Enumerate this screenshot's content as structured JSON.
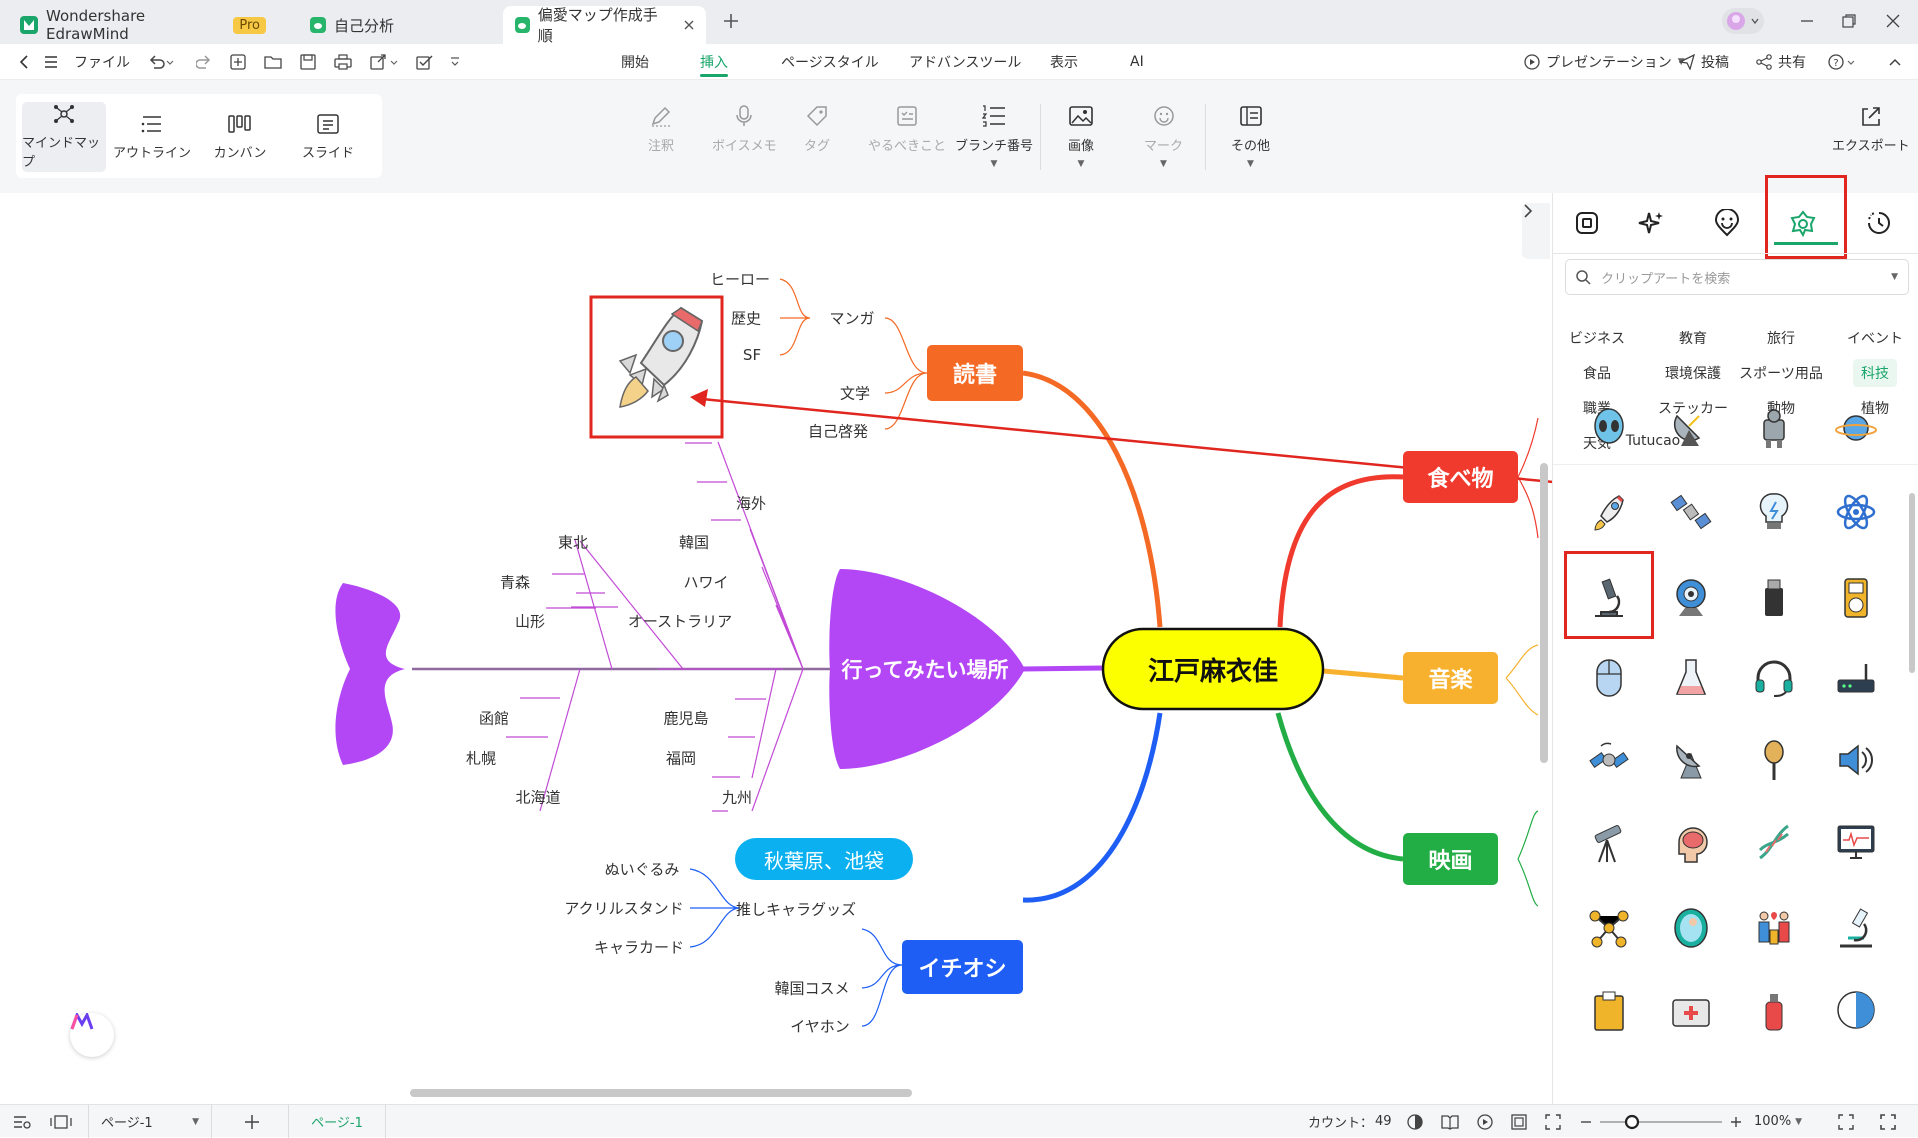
{
  "titlebar": {
    "tabs": [
      {
        "label": "Wondershare EdrawMind",
        "badge": "Pro"
      },
      {
        "label": "自己分析"
      },
      {
        "label": "偏愛マップ作成手順"
      }
    ]
  },
  "menubar": {
    "file": "ファイル",
    "tabs": [
      "開始",
      "挿入",
      "ページスタイル",
      "アドバンスツール",
      "表示",
      "AI"
    ],
    "active": "挿入",
    "present": "プレゼンテーション",
    "post": "投稿",
    "share": "共有"
  },
  "ribbon": {
    "views": [
      "マインドマップ",
      "アウトライン",
      "カンバン",
      "スライド"
    ],
    "tools": [
      "注釈",
      "ボイスメモ",
      "タグ",
      "やるべきこと",
      "ブランチ番号",
      "画像",
      "マーク",
      "その他"
    ],
    "export": "エクスポート"
  },
  "mindmap": {
    "central": "江戸麻衣佳",
    "reading": {
      "label": "読書",
      "sub": [
        "マンガ",
        "文学",
        "自己啓発"
      ],
      "manga": [
        "ヒーロー",
        "歴史",
        "SF"
      ]
    },
    "food": {
      "label": "食べ物"
    },
    "music": {
      "label": "音楽"
    },
    "movie": {
      "label": "映画"
    },
    "places": {
      "label": "行ってみたい場所",
      "top": [
        "海外",
        "韓国",
        "ハワイ",
        "オーストラリア",
        "東北",
        "青森",
        "山形"
      ],
      "bottom": [
        "鹿児島",
        "福岡",
        "九州",
        "函館",
        "札幌",
        "北海道"
      ]
    },
    "oshi": {
      "label": "イチオシ",
      "floating": "秋葉原、池袋",
      "sub": [
        "推しキャラグッズ",
        "韓国コスメ",
        "イヤホン"
      ],
      "goods": [
        "ぬいぐるみ",
        "アクリルスタンド",
        "キャラカード"
      ]
    }
  },
  "panel": {
    "search_placeholder": "クリップアートを検索",
    "categories": [
      [
        "ビジネス",
        "教育",
        "旅行",
        "イベント"
      ],
      [
        "食品",
        "環境保護",
        "スポーツ用品",
        "科技"
      ],
      [
        "職業",
        "ステッカー",
        "動物",
        "植物"
      ],
      [
        "天気",
        "Tutucao"
      ]
    ],
    "selected_category": "科技",
    "clipart": [
      [
        "alien-icon",
        "satellite-dish-icon",
        "robot-icon",
        "planet-icon"
      ],
      [
        "rocket-icon",
        "satellite-icon",
        "lightbulb-icon",
        "atom-icon"
      ],
      [
        "microscope-icon",
        "webcam-icon",
        "usb-drive-icon",
        "mp3-player-icon"
      ],
      [
        "mouse-icon",
        "flask-icon",
        "headset-icon",
        "router-icon"
      ],
      [
        "space-station-icon",
        "radar-icon",
        "microphone-icon",
        "speaker-icon"
      ],
      [
        "telescope-icon",
        "brain-icon",
        "dna-icon",
        "monitor-icon"
      ],
      [
        "molecule-icon",
        "fetus-icon",
        "family-icon",
        "lab-microscope-icon"
      ],
      [
        "clipboard-icon",
        "first-aid-icon",
        "spray-icon",
        "pie-chart-icon"
      ]
    ]
  },
  "statusbar": {
    "page_select": "ページ-1",
    "page_tab": "ページ-1",
    "count_label": "カウント：",
    "count": "49",
    "zoom": "100%"
  },
  "colors": {
    "accent": "#1aa56a",
    "reading": "#f46a25",
    "food": "#f03a2e",
    "music": "#f7b12f",
    "movie": "#23ad45",
    "places": "#b347f5",
    "oshi": "#1e5ef5",
    "central": "#fbff00",
    "highlight": "#e0261e"
  }
}
